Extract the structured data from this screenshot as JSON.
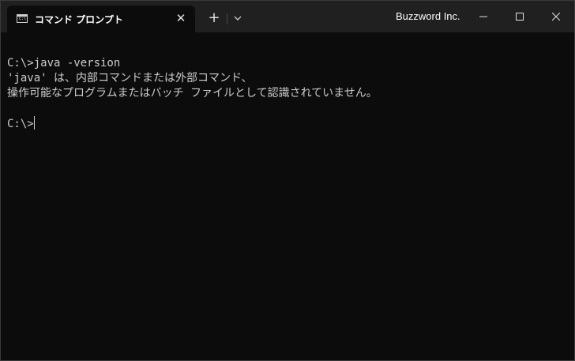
{
  "tab": {
    "title": "コマンド プロンプト",
    "icon_text": "C:\\",
    "close_glyph": "✕"
  },
  "titlebar": {
    "new_tab_glyph": "+",
    "brand": "Buzzword Inc."
  },
  "terminal": {
    "lines": [
      "C:\\>java -version",
      "'java' は、内部コマンドまたは外部コマンド、",
      "操作可能なプログラムまたはバッチ ファイルとして認識されていません。",
      "",
      "C:\\>"
    ]
  },
  "colors": {
    "background": "#0c0c0c",
    "titlebar": "#202020",
    "text": "#cccccc"
  }
}
